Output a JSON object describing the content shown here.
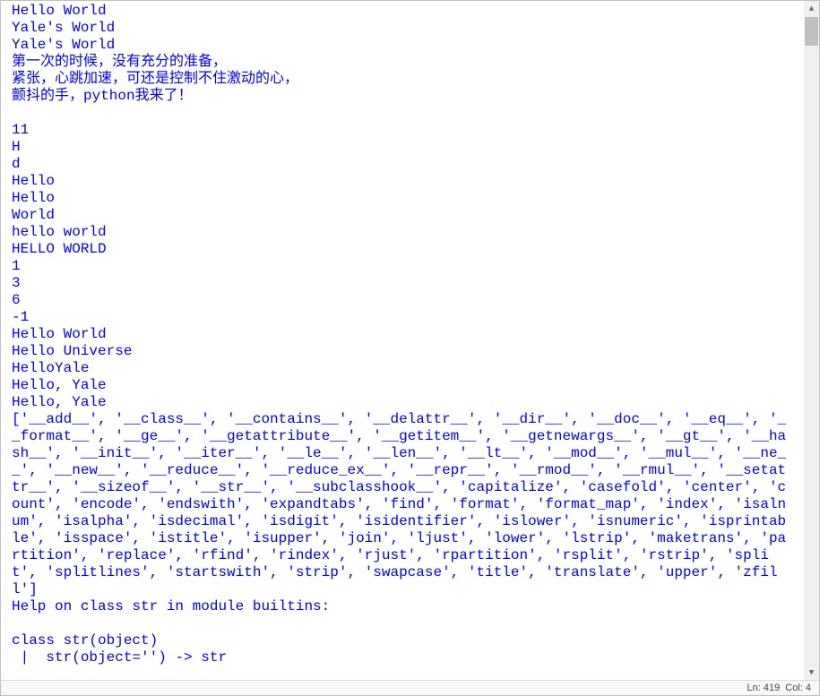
{
  "output_lines": [
    "Hello World",
    "Yale's World",
    "Yale's World",
    "第一次的时候，没有充分的准备，",
    "紧张，心跳加速，可还是控制不住激动的心，",
    "颤抖的手，python我来了！",
    "",
    "11",
    "H",
    "d",
    "Hello",
    "Hello",
    "World",
    "hello world",
    "HELLO WORLD",
    "1",
    "3",
    "6",
    "-1",
    "Hello World",
    "Hello Universe",
    "HelloYale",
    "Hello, Yale",
    "Hello, Yale",
    "['__add__', '__class__', '__contains__', '__delattr__', '__dir__', '__doc__', '__eq__', '__format__', '__ge__', '__getattribute__', '__getitem__', '__getnewargs__', '__gt__', '__hash__', '__init__', '__iter__', '__le__', '__len__', '__lt__', '__mod__', '__mul__', '__ne__', '__new__', '__reduce__', '__reduce_ex__', '__repr__', '__rmod__', '__rmul__', '__setattr__', '__sizeof__', '__str__', '__subclasshook__', 'capitalize', 'casefold', 'center', 'count', 'encode', 'endswith', 'expandtabs', 'find', 'format', 'format_map', 'index', 'isalnum', 'isalpha', 'isdecimal', 'isdigit', 'isidentifier', 'islower', 'isnumeric', 'isprintable', 'isspace', 'istitle', 'isupper', 'join', 'ljust', 'lower', 'lstrip', 'maketrans', 'partition', 'replace', 'rfind', 'rindex', 'rjust', 'rpartition', 'rsplit', 'rstrip', 'split', 'splitlines', 'startswith', 'strip', 'swapcase', 'title', 'translate', 'upper', 'zfill']",
    "Help on class str in module builtins:",
    "",
    "class str(object)",
    " |  str(object='') -> str"
  ],
  "status": {
    "line_label": "Ln: 419",
    "col_label": "Col: 4"
  },
  "scroll": {
    "up_glyph": "▲",
    "down_glyph": "▼"
  }
}
